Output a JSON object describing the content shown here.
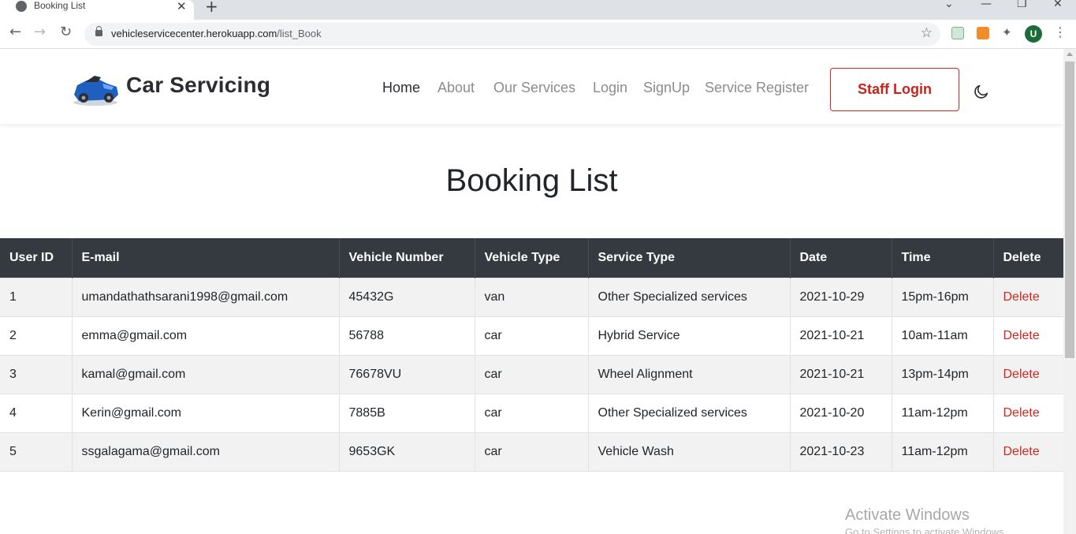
{
  "browser": {
    "tab_title": "Booking List",
    "url_host": "vehicleservicecenter.herokuapp.com",
    "url_path": "/list_Book",
    "profile_initial": "U"
  },
  "nav": {
    "brand": "Car Servicing",
    "links": [
      "Home",
      "About",
      "Our Services",
      "Login",
      "SignUp",
      "Service Register"
    ],
    "active_link": "Home",
    "staff_login": "Staff Login"
  },
  "page_title": "Booking List",
  "table": {
    "columns": [
      "User ID",
      "E-mail",
      "Vehicle Number",
      "Vehicle Type",
      "Service Type",
      "Date",
      "Time",
      "Delete"
    ],
    "rows": [
      [
        "1",
        "umandathathsarani1998@gmail.com",
        "45432G",
        "van",
        "Other Specialized services",
        "2021-10-29",
        "15pm-16pm",
        "Delete"
      ],
      [
        "2",
        "emma@gmail.com",
        "56788",
        "car",
        "Hybrid Service",
        "2021-10-21",
        "10am-11am",
        "Delete"
      ],
      [
        "3",
        "kamal@gmail.com",
        "76678VU",
        "car",
        "Wheel Alignment",
        "2021-10-21",
        "13pm-14pm",
        "Delete"
      ],
      [
        "4",
        "Kerin@gmail.com",
        "7885B",
        "car",
        "Other Specialized services",
        "2021-10-20",
        "11am-12pm",
        "Delete"
      ],
      [
        "5",
        "ssgalagama@gmail.com",
        "9653GK",
        "car",
        "Vehicle Wash",
        "2021-10-23",
        "11am-12pm",
        "Delete"
      ]
    ]
  },
  "watermark": {
    "title": "Activate Windows",
    "subtitle": "Go to Settings to activate Windows."
  },
  "colors": {
    "accent_red": "#d0281f",
    "table_header_bg": "#343a40",
    "stripe": "#f2f2f2"
  },
  "icons": {
    "theme_toggle": "moon-icon",
    "logo": "car-logo-icon"
  }
}
